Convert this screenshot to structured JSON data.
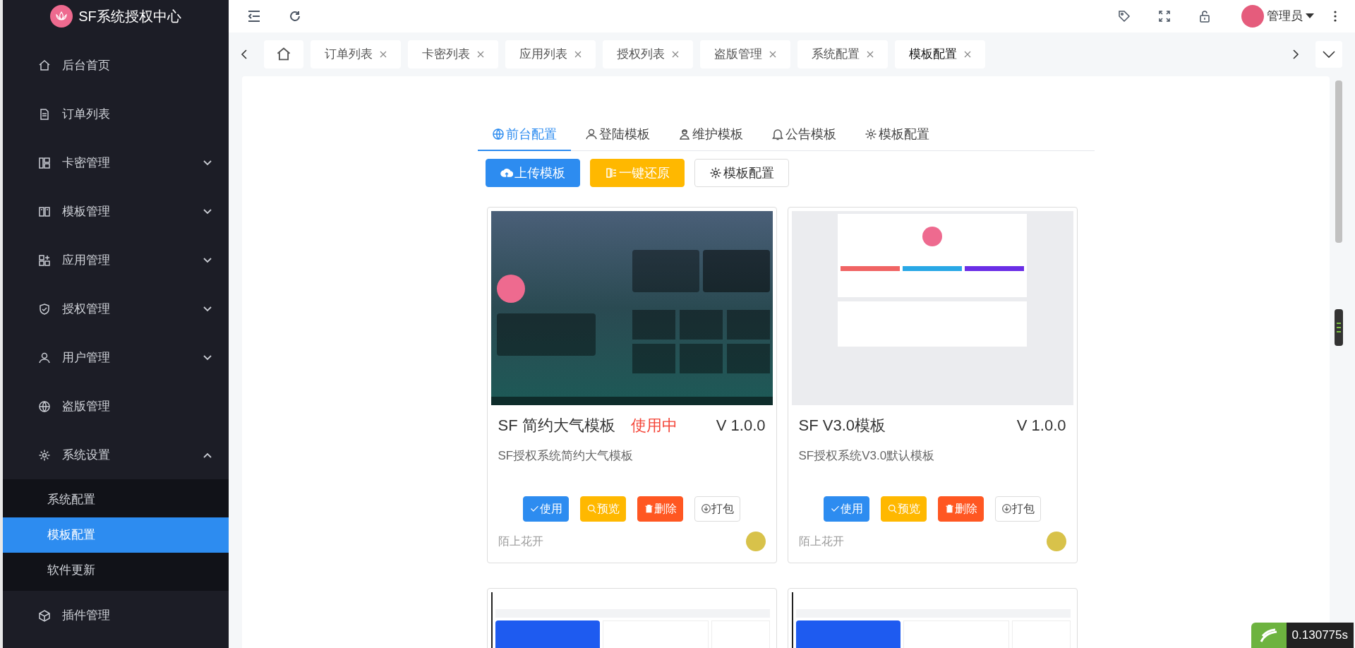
{
  "sidebar": {
    "logo_text": "SF系统授权中心",
    "items": [
      {
        "kind": "home",
        "label": "后台首页"
      },
      {
        "kind": "doc",
        "label": "订单列表"
      },
      {
        "kind": "grid",
        "label": "卡密管理",
        "expanded": false
      },
      {
        "kind": "book",
        "label": "模板管理",
        "expanded": false
      },
      {
        "kind": "apps",
        "label": "应用管理",
        "expanded": false
      },
      {
        "kind": "shield",
        "label": "授权管理",
        "expanded": false
      },
      {
        "kind": "user",
        "label": "用户管理",
        "expanded": false
      },
      {
        "kind": "globe",
        "label": "盗版管理"
      },
      {
        "kind": "gear",
        "label": "系统设置",
        "expanded": true,
        "children": [
          {
            "label": "系统配置",
            "selected": false
          },
          {
            "label": "模板配置",
            "selected": true
          },
          {
            "label": "软件更新",
            "selected": false
          }
        ]
      },
      {
        "kind": "cube",
        "label": "插件管理"
      }
    ]
  },
  "header": {
    "user": "管理员"
  },
  "page_tabs": [
    {
      "kind": "home",
      "selected": false
    },
    {
      "kind": "page",
      "label": "订单列表",
      "selected": false
    },
    {
      "kind": "page",
      "label": "卡密列表",
      "selected": false
    },
    {
      "kind": "page",
      "label": "应用列表",
      "selected": false
    },
    {
      "kind": "page",
      "label": "授权列表",
      "selected": false
    },
    {
      "kind": "page",
      "label": "盗版管理",
      "selected": false
    },
    {
      "kind": "page",
      "label": "系统配置",
      "selected": false
    },
    {
      "kind": "page",
      "label": "模板配置",
      "selected": true
    }
  ],
  "config_tabs": [
    {
      "kind": "globe",
      "label": "前台配置",
      "selected": true
    },
    {
      "kind": "user",
      "label": "登陆模板",
      "selected": false
    },
    {
      "kind": "worker",
      "label": "维护模板",
      "selected": false
    },
    {
      "kind": "bell",
      "label": "公告模板",
      "selected": false
    },
    {
      "kind": "gear",
      "label": "模板配置",
      "selected": false
    }
  ],
  "toolbar_buttons": [
    {
      "kind": "upload",
      "label": "上传模板"
    },
    {
      "kind": "restore",
      "label": "一键还原"
    },
    {
      "kind": "settings",
      "label": "模板配置"
    }
  ],
  "templates": [
    {
      "kind": "dark",
      "name": "SF 简约大气模板",
      "status": "使用中",
      "version": "V 1.0.0",
      "description": "SF授权系统简约大气模板",
      "author": "陌上花开",
      "actions": [
        {
          "kind": "use",
          "label": "使用"
        },
        {
          "kind": "preview",
          "label": "预览"
        },
        {
          "kind": "delete",
          "label": "删除"
        },
        {
          "kind": "pack",
          "label": "打包"
        }
      ]
    },
    {
      "kind": "light",
      "name": "SF V3.0模板",
      "version": "V 1.0.0",
      "description": "SF授权系统V3.0默认模板",
      "author": "陌上花开",
      "actions": [
        {
          "kind": "use",
          "label": "使用"
        },
        {
          "kind": "preview",
          "label": "预览"
        },
        {
          "kind": "delete",
          "label": "删除"
        },
        {
          "kind": "pack",
          "label": "打包"
        }
      ]
    },
    {
      "kind": "dashboard"
    },
    {
      "kind": "dashboard"
    }
  ],
  "timer": {
    "text": "0.130775s"
  }
}
